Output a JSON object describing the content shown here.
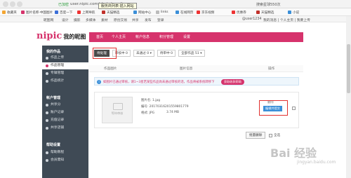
{
  "browser": {
    "verified": "已加密",
    "url": "user.nipic.com/photo/pending",
    "tooltip": "服务商列表·插入网站",
    "right_search": "搜索星球550次"
  },
  "bookmarks": [
    {
      "label": "收藏夹",
      "color": "#f3a531"
    },
    {
      "label": "图片名称·中国图片",
      "color": "#d6336c"
    },
    {
      "label": "百度一下",
      "color": "#3b6fd8"
    },
    {
      "label": "上网导航",
      "color": "#e33"
    },
    {
      "label": "天猫精选",
      "color": "#c0312b"
    },
    {
      "label": "网站中心",
      "color": "#3b8fd8"
    },
    {
      "label": "links",
      "color": "#bbb"
    },
    {
      "label": "在线网页",
      "color": "#3b8fd8"
    },
    {
      "label": "京东视频",
      "color": "#e33"
    },
    {
      "label": "优惠券",
      "color": "#e33"
    },
    {
      "label": "天猫精选",
      "color": "#c0312b"
    },
    {
      "label": "小说",
      "color": "#3b8fd8"
    }
  ],
  "site_nav": {
    "items": [
      "昵图网",
      "设计",
      "摄影",
      "多媒体",
      "素材",
      "原创交易",
      "共享",
      "发布",
      "登录"
    ],
    "user": "@user1234",
    "right_links": "我的消息 | 个人主页 | 我要上传"
  },
  "header": {
    "logo": "nipic",
    "logo_text": "我的昵图",
    "tabs": [
      "首页",
      "个人主页",
      "帐户信息",
      "积分管理",
      "设置"
    ]
  },
  "sidebar": {
    "group1": "我的作品",
    "group1_items": [
      "作品上传",
      "作品管理",
      "专辑管理",
      "作品统计"
    ],
    "group2": "帐户管理",
    "group2_items": [
      "共享分",
      "账户记录",
      "充值记录",
      "共享店铺"
    ],
    "group3": "帮助设置",
    "group3_items": [
      "帮助教程",
      "会员需知"
    ],
    "active": "作品管理"
  },
  "filters": [
    {
      "label": "待处理",
      "selected": true
    },
    {
      "label": "审核中 0",
      "selected": false
    },
    {
      "label": "未通过 0 ▾",
      "selected": false
    },
    {
      "label": "待审中 0",
      "selected": false
    },
    {
      "label": "全部作品 51 ▾",
      "selected": false
    }
  ],
  "columns": [
    "作品图片",
    "图片信息",
    "操作"
  ],
  "notice": {
    "text": "如图片已通过审核，请1~3星若某些作品尚未通过审核的话，作品将被系统转移下",
    "button": "获取收款帮助"
  },
  "item": {
    "thumb_label": "等待审核",
    "name": "图片名: 1.jpg",
    "number": "编号: 20170316201559801779",
    "format": "格式: JPG",
    "size": "3.74 MB",
    "status": "删除",
    "action": "编辑并提交"
  },
  "footer": {
    "bulk_delete": "批量删除",
    "select_all": "全选"
  },
  "watermark": {
    "main": "Bai 经验",
    "sub": "jingyan.baidu.com"
  }
}
